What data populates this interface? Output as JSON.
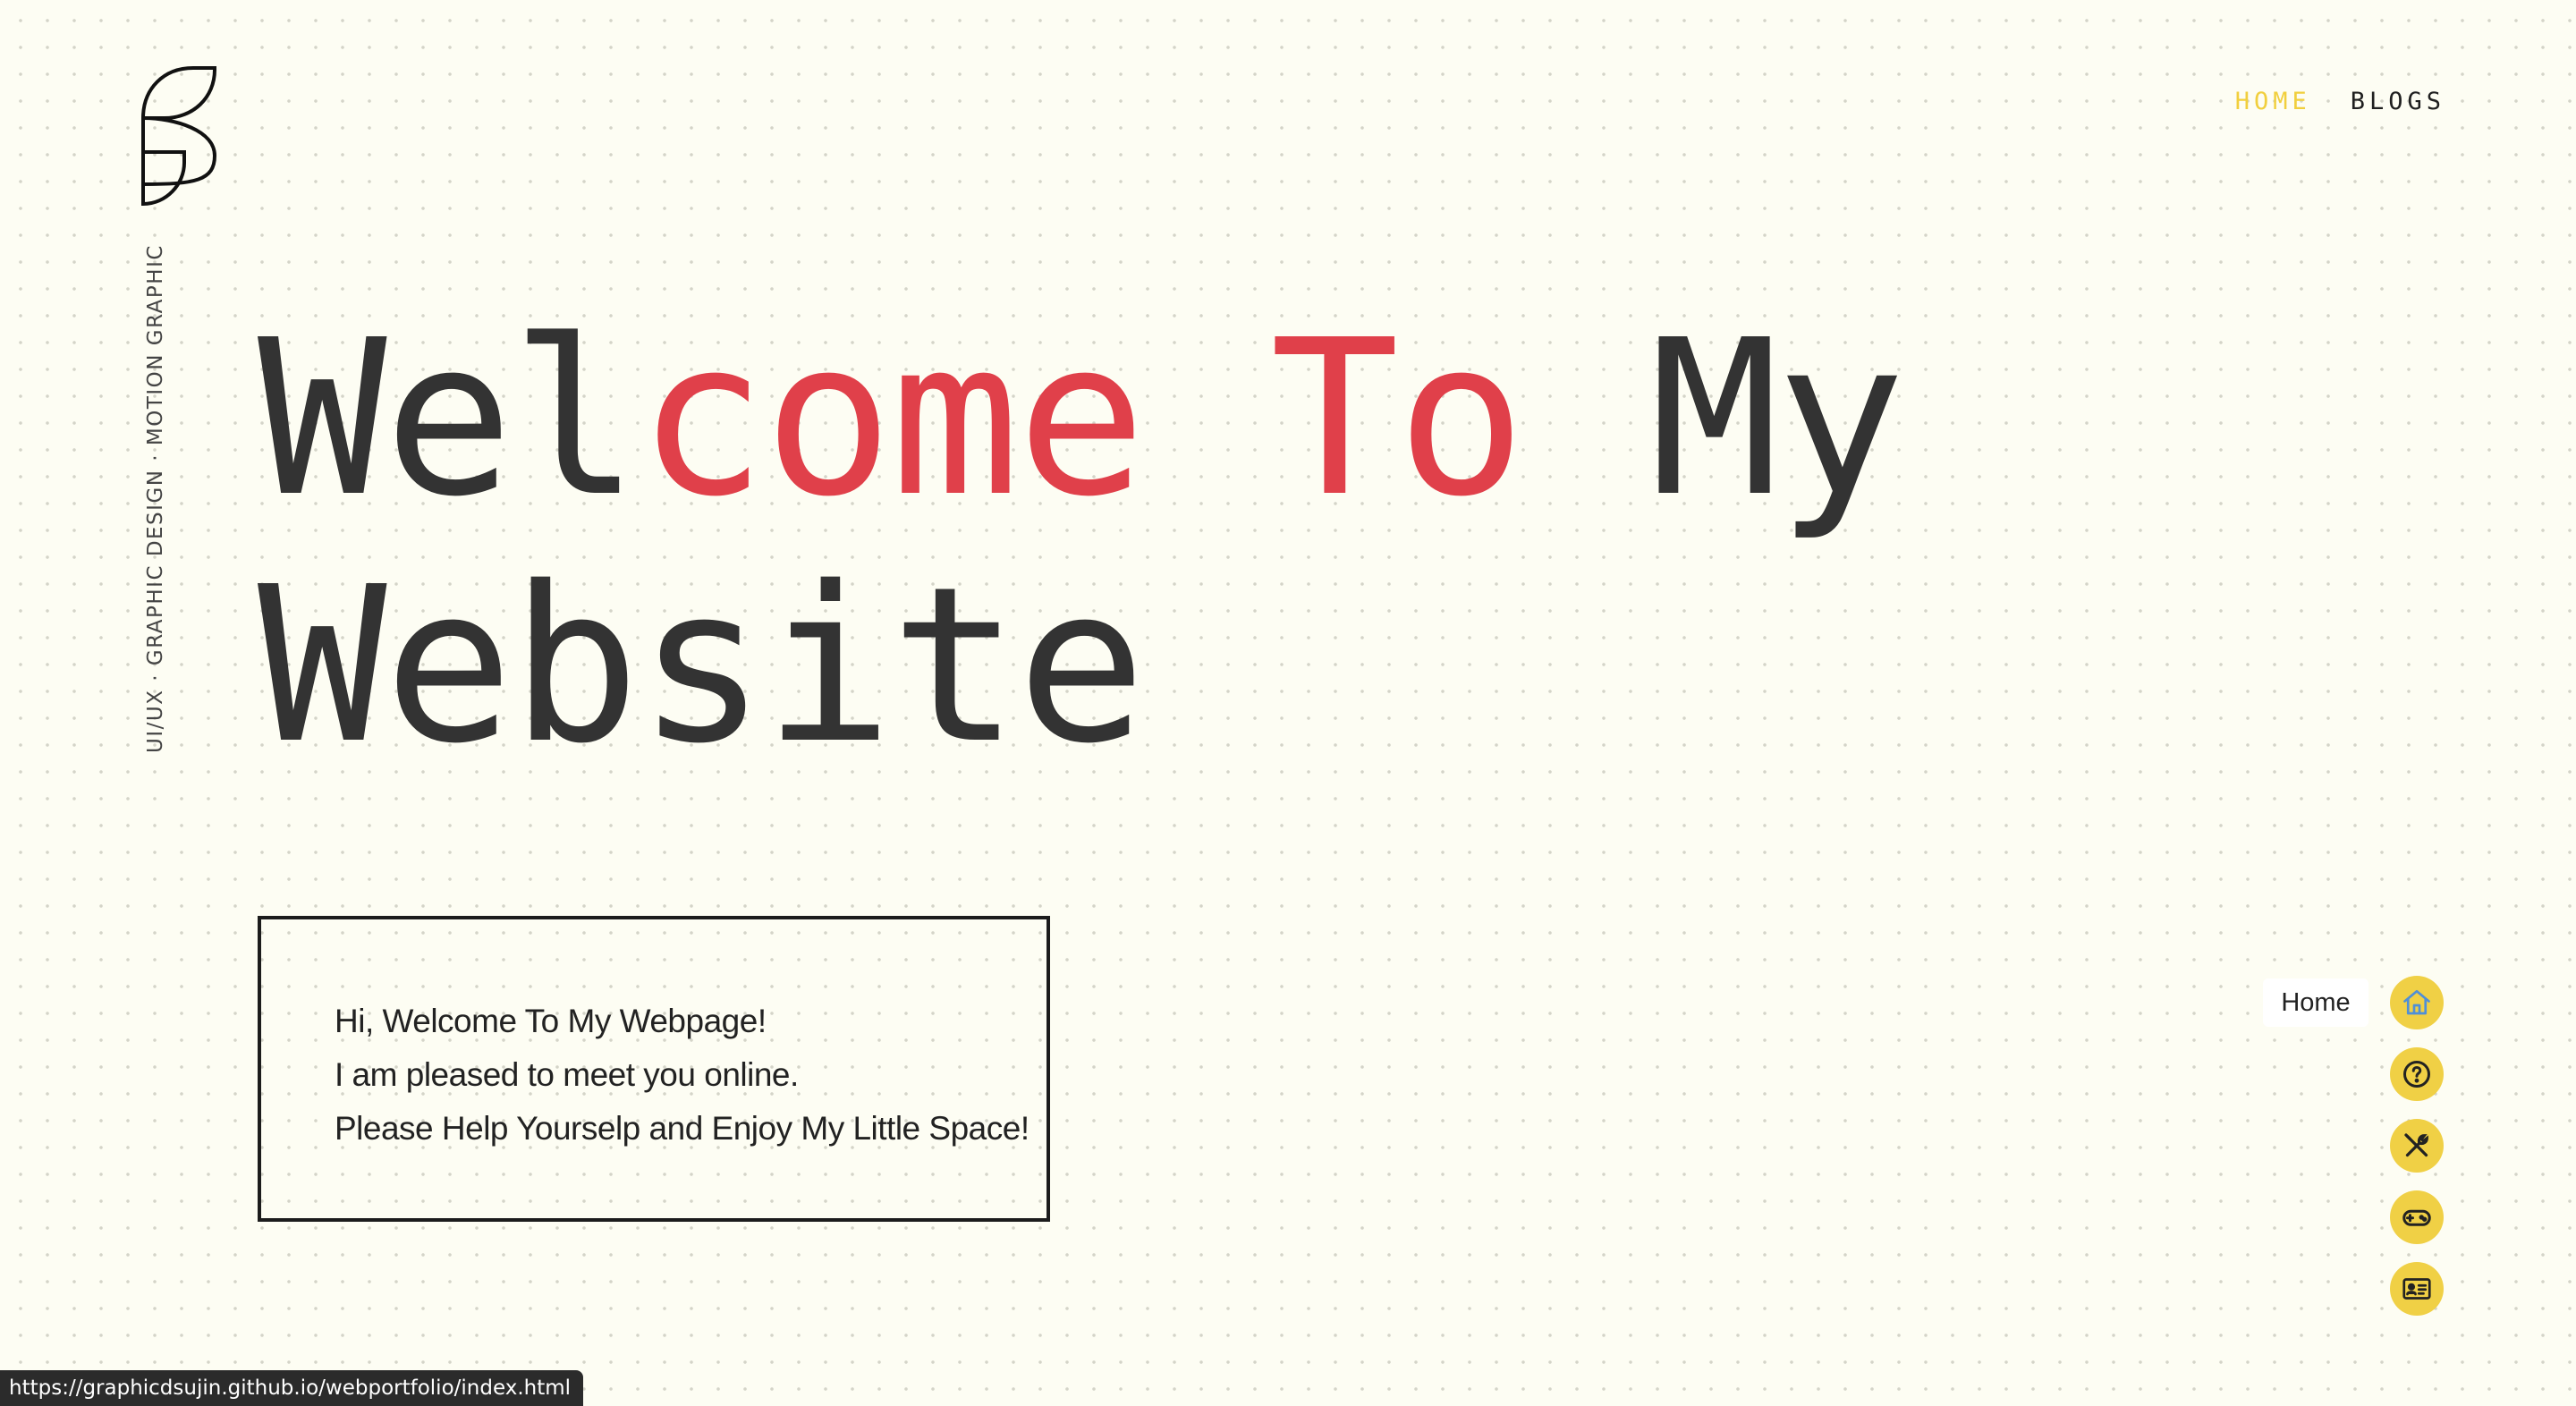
{
  "header": {
    "nav": [
      {
        "id": "home",
        "label": "HOME"
      },
      {
        "id": "blogs",
        "label": "BLOGS"
      }
    ]
  },
  "sidebar": {
    "tagline": "UI/UX · GRAPHIC DESIGN · MOTION GRAPHIC"
  },
  "hero": {
    "line1": {
      "part1": "Wel",
      "part2": "come To",
      "part3": " My"
    },
    "line2": "Website"
  },
  "intro": {
    "lines": [
      "Hi, Welcome To My Webpage!",
      "I am pleased to meet you online.",
      "Please Help Yourselp and Enjoy My Little Space!"
    ]
  },
  "side_nav": {
    "tooltip": "Home",
    "items": [
      {
        "icon": "home-icon"
      },
      {
        "icon": "question-circle-icon"
      },
      {
        "icon": "tools-icon"
      },
      {
        "icon": "gamepad-icon"
      },
      {
        "icon": "id-card-icon"
      }
    ]
  },
  "status_bar": {
    "url": "https://graphicdsujin.github.io/webportfolio/index.html"
  },
  "colors": {
    "background": "#fdfdf3",
    "accent_yellow": "#f0d045",
    "accent_red": "#e0404a",
    "text_dark": "#333333"
  }
}
